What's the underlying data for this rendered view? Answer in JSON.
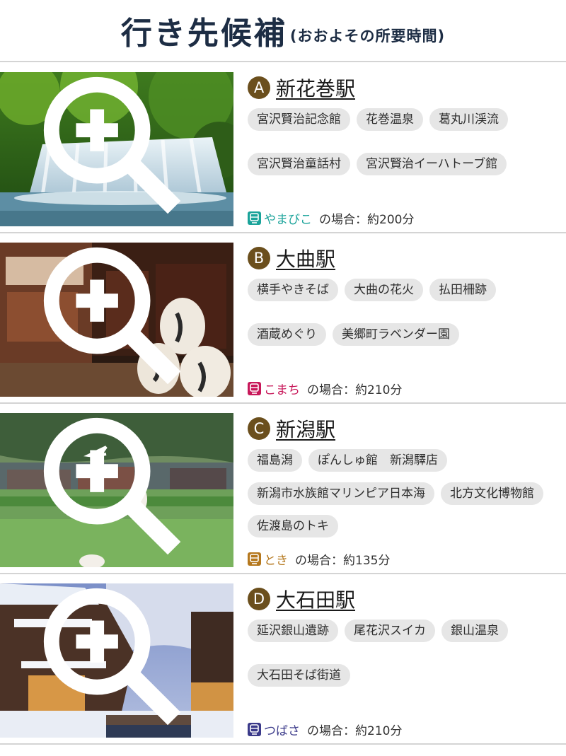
{
  "header": {
    "title": "行き先候補",
    "subtitle": "(おおよその所要時間)"
  },
  "cards": [
    {
      "letter": "A",
      "station": "新花巻駅",
      "tags": [
        "宮沢賢治記念館",
        "花巻温泉",
        "葛丸川渓流",
        "宮沢賢治童話村",
        "宮沢賢治イーハトーブ館"
      ],
      "train": "やまびこ",
      "train_color": "#1aa39a",
      "time_text": "の場合：約200分"
    },
    {
      "letter": "B",
      "station": "大曲駅",
      "tags": [
        "横手やきそば",
        "大曲の花火",
        "払田柵跡",
        "酒蔵めぐり",
        "美郷町ラベンダー園"
      ],
      "train": "こまち",
      "train_color": "#c8185a",
      "time_text": "の場合：約210分"
    },
    {
      "letter": "C",
      "station": "新潟駅",
      "tags": [
        "福島潟",
        "ぽんしゅ館　新潟驛店",
        "新潟市水族館マリンピア日本海",
        "北方文化博物館",
        "佐渡島のトキ"
      ],
      "train": "とき",
      "train_color": "#b5781e",
      "time_text": "の場合：約135分"
    },
    {
      "letter": "D",
      "station": "大石田駅",
      "tags": [
        "延沢銀山遺跡",
        "尾花沢スイカ",
        "銀山温泉",
        "大石田そば街道"
      ],
      "train": "つばさ",
      "train_color": "#3b3a8a",
      "time_text": "の場合：約210分"
    }
  ]
}
